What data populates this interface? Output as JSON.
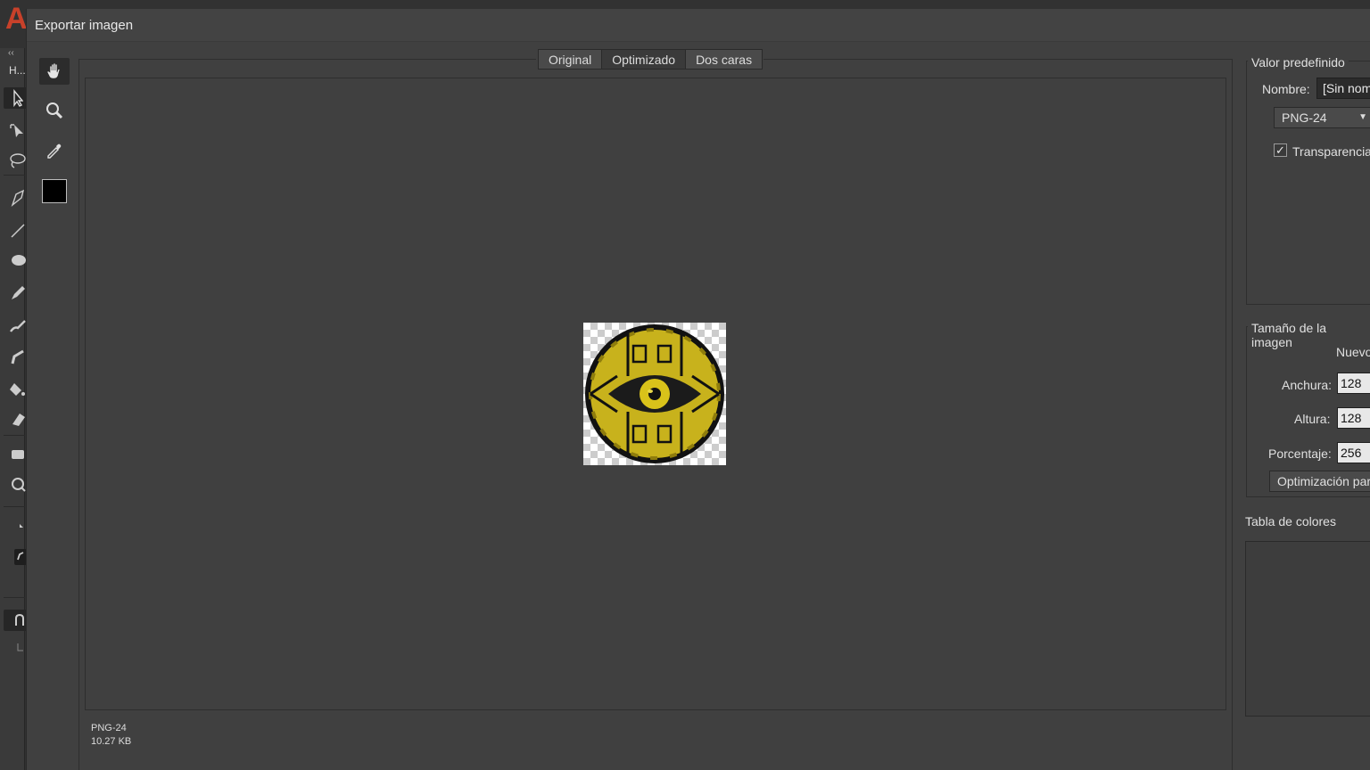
{
  "app": {
    "logo_letter": "A",
    "panel_header": "H...",
    "collapse_glyph": "‹‹"
  },
  "dialog": {
    "title": "Exportar imagen",
    "tabs": [
      {
        "label": "Original"
      },
      {
        "label": "Optimizado",
        "active": true
      },
      {
        "label": "Dos caras"
      }
    ],
    "file_info": {
      "format": "PNG-24",
      "size": "10.27 KB"
    }
  },
  "tools": {
    "items": [
      "hand-tool",
      "zoom-tool",
      "eyedropper-tool"
    ],
    "swatch_color": "#000000"
  },
  "preset": {
    "title": "Valor predefinido",
    "name_label": "Nombre:",
    "name_value": "[Sin nombre]",
    "format_value": "PNG-24",
    "transparency_label": "Transparencia",
    "transparency_checked": true
  },
  "image_size": {
    "title": "Tamaño de la imagen",
    "new_label": "Nuevo",
    "width_label": "Anchura:",
    "width_value": "128",
    "height_label": "Altura:",
    "height_value": "128",
    "percent_label": "Porcentaje:",
    "percent_value": "256",
    "optimize_button": "Optimización para"
  },
  "color_table": {
    "title": "Tabla de colores"
  },
  "colors": {
    "emblem_gold": "#c8b21c",
    "emblem_dark": "#1b1b1b",
    "accent_red": "#c8412a"
  }
}
